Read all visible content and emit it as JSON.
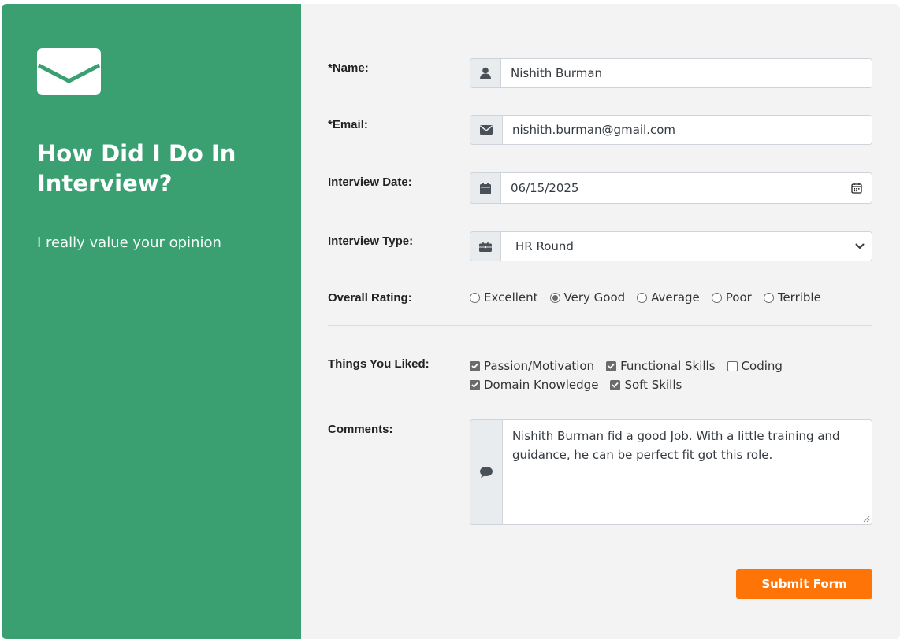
{
  "sidebar": {
    "icon": "envelope-icon",
    "title": "How Did I Do In Interview?",
    "subtitle": "I really value your opinion",
    "bg_color": "#3aa072"
  },
  "form": {
    "name": {
      "label": "*Name:",
      "value": "Nishith Burman",
      "icon": "user-icon"
    },
    "email": {
      "label": "*Email:",
      "value": "nishith.burman@gmail.com",
      "icon": "envelope-icon"
    },
    "date": {
      "label": "Interview Date:",
      "value": "06/15/2025",
      "icon": "calendar-icon"
    },
    "type": {
      "label": "Interview Type:",
      "value": "HR Round",
      "icon": "briefcase-icon"
    },
    "rating": {
      "label": "Overall Rating:",
      "options": [
        "Excellent",
        "Very Good",
        "Average",
        "Poor",
        "Terrible"
      ],
      "selected": "Very Good"
    },
    "liked": {
      "label": "Things You Liked:",
      "options": [
        {
          "label": "Passion/Motivation",
          "checked": true
        },
        {
          "label": "Functional Skills",
          "checked": true
        },
        {
          "label": "Coding",
          "checked": false
        },
        {
          "label": "Domain Knowledge",
          "checked": true
        },
        {
          "label": "Soft Skills",
          "checked": true
        }
      ]
    },
    "comments": {
      "label": "Comments:",
      "value": "Nishith Burman fid a good Job. With a little training and guidance, he can be perfect fit got this role.",
      "icon": "comment-icon"
    },
    "submit_label": "Submit Form",
    "accent_color": "#ff7407"
  }
}
